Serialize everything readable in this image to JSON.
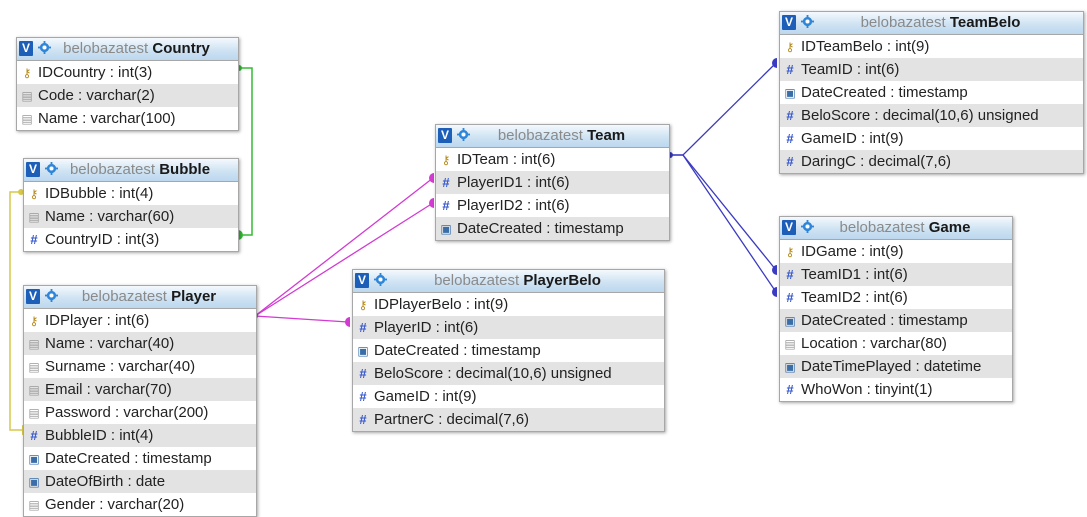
{
  "colors": {
    "green": "#33bb33",
    "yellow": "#d6c94a",
    "magenta": "#d23ad2",
    "blue": "#3a3ac2"
  },
  "tables": {
    "country": {
      "db": "belobazatest",
      "name": "Country",
      "fields": [
        {
          "icon": "key-icon",
          "label": "IDCountry : int(3)"
        },
        {
          "icon": "text-icon",
          "label": "Code : varchar(2)"
        },
        {
          "icon": "text-icon",
          "label": "Name : varchar(100)"
        }
      ]
    },
    "bubble": {
      "db": "belobazatest",
      "name": "Bubble",
      "fields": [
        {
          "icon": "key-icon",
          "label": "IDBubble : int(4)"
        },
        {
          "icon": "text-icon",
          "label": "Name : varchar(60)"
        },
        {
          "icon": "hash-icon",
          "label": "CountryID : int(3)"
        }
      ]
    },
    "player": {
      "db": "belobazatest",
      "name": "Player",
      "fields": [
        {
          "icon": "key-icon",
          "label": "IDPlayer : int(6)"
        },
        {
          "icon": "text-icon",
          "label": "Name : varchar(40)"
        },
        {
          "icon": "text-icon",
          "label": "Surname : varchar(40)"
        },
        {
          "icon": "text-icon",
          "label": "Email : varchar(70)"
        },
        {
          "icon": "text-icon",
          "label": "Password : varchar(200)"
        },
        {
          "icon": "hash-icon",
          "label": "BubbleID : int(4)"
        },
        {
          "icon": "date-icon",
          "label": "DateCreated : timestamp"
        },
        {
          "icon": "date-icon",
          "label": "DateOfBirth : date"
        },
        {
          "icon": "text-icon",
          "label": "Gender : varchar(20)"
        }
      ]
    },
    "team": {
      "db": "belobazatest",
      "name": "Team",
      "fields": [
        {
          "icon": "key-icon",
          "label": "IDTeam : int(6)"
        },
        {
          "icon": "hash-icon",
          "label": "PlayerID1 : int(6)"
        },
        {
          "icon": "hash-icon",
          "label": "PlayerID2 : int(6)"
        },
        {
          "icon": "date-icon",
          "label": "DateCreated : timestamp"
        }
      ]
    },
    "playerbelo": {
      "db": "belobazatest",
      "name": "PlayerBelo",
      "fields": [
        {
          "icon": "key-icon",
          "label": "IDPlayerBelo : int(9)"
        },
        {
          "icon": "hash-icon",
          "label": "PlayerID : int(6)"
        },
        {
          "icon": "date-icon",
          "label": "DateCreated : timestamp"
        },
        {
          "icon": "hash-icon",
          "label": "BeloScore : decimal(10,6) unsigned"
        },
        {
          "icon": "hash-icon",
          "label": "GameID : int(9)"
        },
        {
          "icon": "hash-icon",
          "label": "PartnerC : decimal(7,6)"
        }
      ]
    },
    "teambelo": {
      "db": "belobazatest",
      "name": "TeamBelo",
      "fields": [
        {
          "icon": "key-icon",
          "label": "IDTeamBelo : int(9)"
        },
        {
          "icon": "hash-icon",
          "label": "TeamID : int(6)"
        },
        {
          "icon": "date-icon",
          "label": "DateCreated : timestamp"
        },
        {
          "icon": "hash-icon",
          "label": "BeloScore : decimal(10,6) unsigned"
        },
        {
          "icon": "hash-icon",
          "label": "GameID : int(9)"
        },
        {
          "icon": "hash-icon",
          "label": "DaringC : decimal(7,6)"
        }
      ]
    },
    "game": {
      "db": "belobazatest",
      "name": "Game",
      "fields": [
        {
          "icon": "key-icon",
          "label": "IDGame : int(9)"
        },
        {
          "icon": "hash-icon",
          "label": "TeamID1 : int(6)"
        },
        {
          "icon": "hash-icon",
          "label": "TeamID2 : int(6)"
        },
        {
          "icon": "date-icon",
          "label": "DateCreated : timestamp"
        },
        {
          "icon": "text-icon",
          "label": "Location : varchar(80)"
        },
        {
          "icon": "date-icon",
          "label": "DateTimePlayed : datetime"
        },
        {
          "icon": "hash-icon",
          "label": "WhoWon : tinyint(1)"
        }
      ]
    }
  }
}
